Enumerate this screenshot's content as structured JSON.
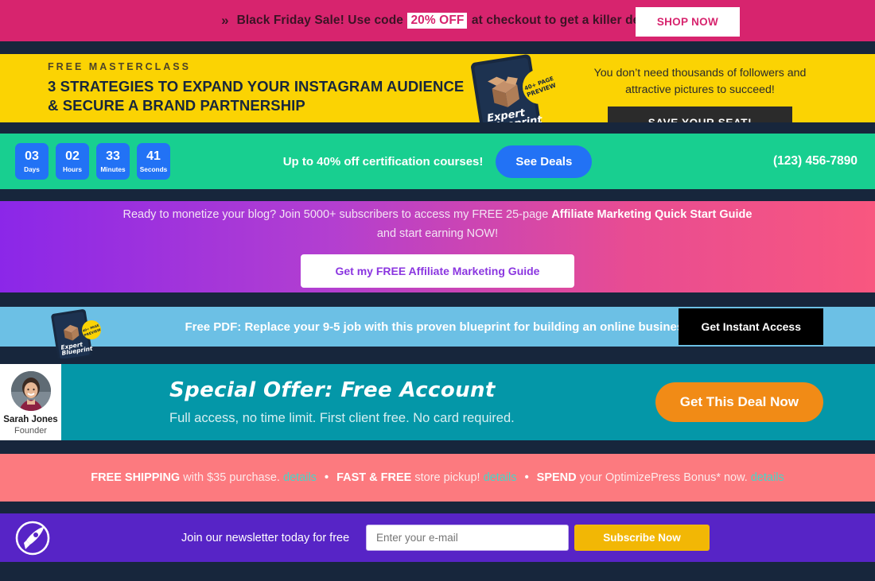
{
  "blackfriday": {
    "chevron_icon": "double-chevron-right-icon",
    "text_before": "Black Friday Sale! Use code",
    "code": "20% OFF",
    "text_after": "at checkout to get a killer deal.",
    "button_label": "SHOP NOW",
    "bg_color": "#d7246e",
    "text_color": "#3c1325"
  },
  "masterclass": {
    "kicker": "FREE MASTERCLASS",
    "title_line1": "3 STRATEGIES TO EXPAND YOUR INSTAGRAM AUDIENCE",
    "title_line2": "& SECURE A BRAND PARTNERSHIP",
    "book_title_line1": "Expert",
    "book_title_line2": "Blueprint",
    "badge_line1": "40+ PAGE",
    "badge_line2": "PREVIEW",
    "subtitle_line1": "You don’t need thousands of followers and",
    "subtitle_line2": "attractive pictures to succeed!",
    "button_label": "SAVE YOUR SEAT!",
    "bg_color": "#fbd303"
  },
  "countdown": {
    "units": [
      {
        "value": "03",
        "label": "Days"
      },
      {
        "value": "02",
        "label": "Hours"
      },
      {
        "value": "33",
        "label": "Minutes"
      },
      {
        "value": "41",
        "label": "Seconds"
      }
    ],
    "offer_text": "Up to 40% off certification courses!",
    "button_label": "See Deals",
    "phone": "(123) 456-7890",
    "bg_color": "#18cf90",
    "unit_color": "#2272f5"
  },
  "affiliate": {
    "text_before": "Ready to monetize your blog? Join 5000+ subscribers to access my FREE 25-page",
    "text_bold": "Affiliate Marketing Quick Start Guide",
    "text_after": "and start earning NOW!",
    "button_label": "Get my FREE Affiliate Marketing Guide",
    "gradient_start": "#8b27e8",
    "gradient_end": "#f8577f"
  },
  "freepdf": {
    "book_title_line1": "Expert",
    "book_title_line2": "Blueprint",
    "badge_line1": "40+ PAGE",
    "badge_line2": "PREVIEW",
    "text": "Free PDF: Replace your 9-5 job with this proven blueprint for building an online business",
    "button_label": "Get Instant Access",
    "bg_color": "#6cc0e5"
  },
  "offer": {
    "avatar_name": "Sarah Jones",
    "avatar_role": "Founder",
    "title": "Special Offer: Free Account",
    "subtitle": "Full access, no time limit. First client free. No card required.",
    "button_label": "Get This Deal Now",
    "bg_color": "#0497a8",
    "button_color": "#f18b16"
  },
  "shipping": {
    "item1_bold": "FREE SHIPPING",
    "item1_text": "with $35 purchase.",
    "item1_link": "details",
    "item2_bold": "FAST & FREE",
    "item2_text": "store pickup!",
    "item2_link": "details",
    "item3_bold": "SPEND",
    "item3_text": "your OptimizePress Bonus* now.",
    "item3_link": "details",
    "separator": "•",
    "bg_color": "#fc7a7f",
    "link_color": "#47d6c7"
  },
  "newsletter": {
    "logo_icon": "rocket-icon",
    "text": "Join our newsletter today for free",
    "input_value": "",
    "input_placeholder": "Enter your e-mail",
    "button_label": "Subscribe Now",
    "bg_color": "#5724c6",
    "button_color": "#f2b705"
  }
}
